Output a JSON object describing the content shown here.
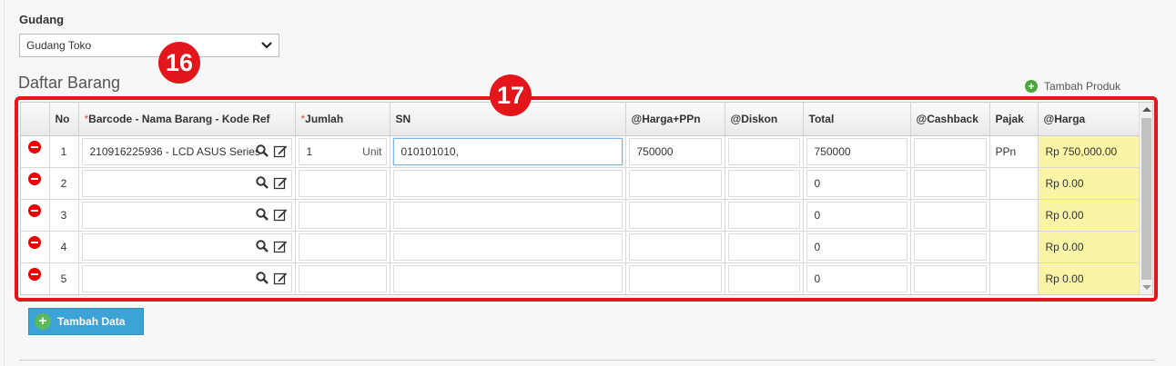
{
  "gudang": {
    "label": "Gudang",
    "selected": "Gudang Toko"
  },
  "badges": {
    "b16": "16",
    "b17": "17"
  },
  "section_title": "Daftar Barang",
  "tambah_produk": "Tambah Produk",
  "headers": [
    "",
    "No",
    "Barcode - Nama Barang - Kode Ref",
    "Jumlah",
    "SN",
    "@Harga+PPn",
    "@Diskon",
    "Total",
    "@Cashback",
    "Pajak",
    "@Harga"
  ],
  "required_mark": "*",
  "rows": [
    {
      "no": "1",
      "barang": "210916225936 - LCD ASUS Series",
      "jumlah": "1",
      "unit": "Unit",
      "sn": "010101010,",
      "harga_ppn": "750000",
      "diskon": "",
      "total": "750000",
      "cashback": "",
      "pajak": "PPn",
      "harga": "Rp 750,000.00"
    },
    {
      "no": "2",
      "barang": "",
      "jumlah": "",
      "unit": "",
      "sn": "",
      "harga_ppn": "",
      "diskon": "",
      "total": "0",
      "cashback": "",
      "pajak": "",
      "harga": "Rp 0.00"
    },
    {
      "no": "3",
      "barang": "",
      "jumlah": "",
      "unit": "",
      "sn": "",
      "harga_ppn": "",
      "diskon": "",
      "total": "0",
      "cashback": "",
      "pajak": "",
      "harga": "Rp 0.00"
    },
    {
      "no": "4",
      "barang": "",
      "jumlah": "",
      "unit": "",
      "sn": "",
      "harga_ppn": "",
      "diskon": "",
      "total": "0",
      "cashback": "",
      "pajak": "",
      "harga": "Rp 0.00"
    },
    {
      "no": "5",
      "barang": "",
      "jumlah": "",
      "unit": "",
      "sn": "",
      "harga_ppn": "",
      "diskon": "",
      "total": "0",
      "cashback": "",
      "pajak": "",
      "harga": "Rp 0.00"
    }
  ],
  "tambah_data": "Tambah Data",
  "icons": {
    "remove": "remove-circle-icon",
    "search": "search-icon",
    "edit": "edit-icon",
    "add": "plus-circle-icon",
    "dropdown": "chevron-down-icon"
  },
  "colors": {
    "annotation_red": "#e3161c",
    "harga_bg": "#faf5a6",
    "button_blue": "#3ba3d6",
    "add_green": "#4ba93c"
  }
}
